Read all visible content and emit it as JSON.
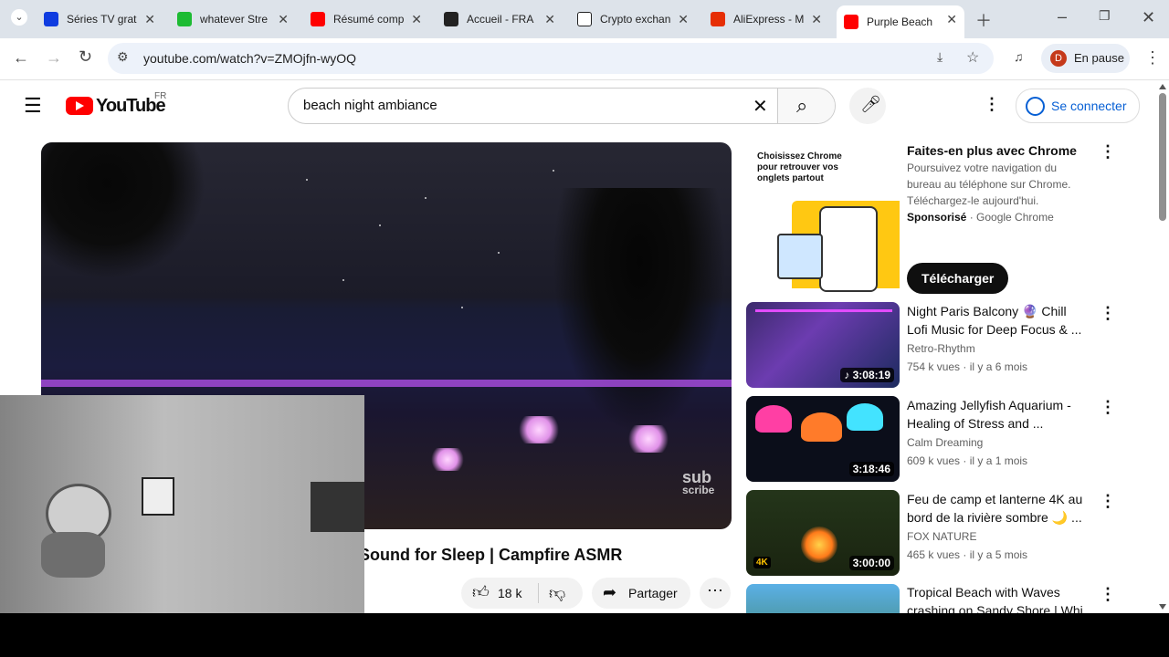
{
  "browser": {
    "tabs": [
      {
        "title": "Séries TV grat",
        "color": "#0f3ce0"
      },
      {
        "title": "whatever Stre",
        "color": "#1dbb33"
      },
      {
        "title": "Résumé comp",
        "color": "#ff0000"
      },
      {
        "title": "Accueil - FRA",
        "color": "#222222"
      },
      {
        "title": "Crypto exchan",
        "color": "#ffffff"
      },
      {
        "title": "AliExpress - M",
        "color": "#e62e04"
      },
      {
        "title": "Purple Beach",
        "color": "#ff0000"
      }
    ],
    "url": "youtube.com/watch?v=ZMOjfn-wyOQ",
    "profile_initial": "D",
    "profile_status": "En pause"
  },
  "youtube": {
    "logo": "YouTube",
    "region": "FR",
    "search_query": "beach night ambiance",
    "signin": "Se connecter"
  },
  "video": {
    "title": "Sound for Sleep | Campfire ASMR",
    "likes": "18 k",
    "share": "Partager",
    "overlay_sub": "sub",
    "overlay_scribe": "scribe"
  },
  "ad": {
    "image_text": "Choisissez Chrome pour retrouver vos onglets partout",
    "title": "Faites-en plus avec Chrome",
    "desc": "Poursuivez votre navigation du bureau au téléphone sur Chrome. Téléchargez-le aujourd'hui.",
    "sponsored": "Sponsorisé",
    "advertiser": "Google Chrome",
    "cta": "Télécharger"
  },
  "sidebar": [
    {
      "title1": "Night Paris Balcony 🔮 Chill",
      "title2": "Lofi Music for Deep Focus & ...",
      "channel": "Retro-Rhythm",
      "meta": "754 k vues · il y a 6 mois",
      "duration": "♪ 3:08:19",
      "bg": "#2a1e55"
    },
    {
      "title1": "Amazing Jellyfish Aquarium -",
      "title2": "Healing of Stress and ...",
      "channel": "Calm Dreaming",
      "meta": "609 k vues · il y a 1 mois",
      "duration": "3:18:46",
      "bg": "#0b0e1a"
    },
    {
      "title1": "Feu de camp et lanterne 4K au",
      "title2": "bord de la rivière sombre 🌙 ...",
      "channel": "FOX NATURE",
      "meta": "465 k vues · il y a 5 mois",
      "duration": "3:00:00",
      "bg": "#1f2a14"
    },
    {
      "title1": "Tropical Beach with Waves",
      "title2": "crashing on Sandy Shore | Whi...",
      "channel": "",
      "meta": "",
      "duration": "",
      "bg": "#3a7a54"
    }
  ]
}
